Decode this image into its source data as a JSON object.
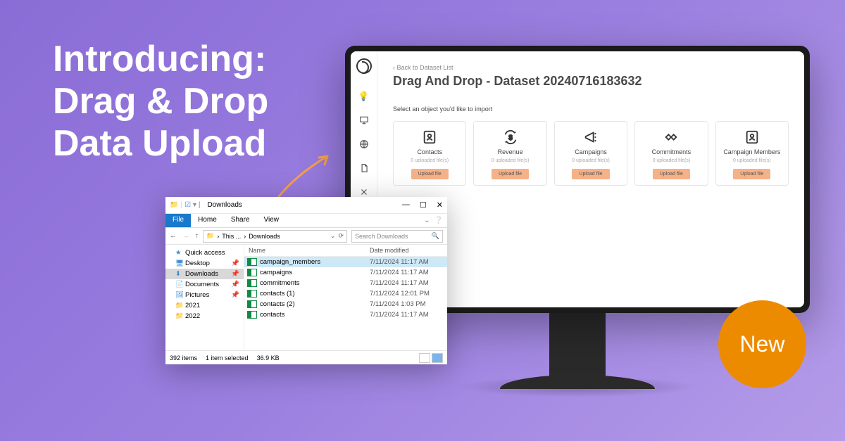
{
  "hero": {
    "line1": "Introducing:",
    "line2": "Drag & Drop",
    "line3": "Data Upload"
  },
  "badge": {
    "label": "New"
  },
  "app": {
    "back_link": "‹ Back to Dataset List",
    "title": "Drag And Drop - Dataset 20240716183632",
    "instruction": "Select an object you'd like to import",
    "upload_label": "Upload file",
    "cards": [
      {
        "name": "Contacts",
        "sub": "0 uploaded file(s)"
      },
      {
        "name": "Revenue",
        "sub": "0 uploaded file(s)"
      },
      {
        "name": "Campaigns",
        "sub": "0 uploaded file(s)"
      },
      {
        "name": "Commitments",
        "sub": "0 uploaded file(s)"
      },
      {
        "name": "Campaign Members",
        "sub": "0 uploaded file(s)"
      }
    ]
  },
  "explorer": {
    "title": "Downloads",
    "tabs": {
      "file": "File",
      "home": "Home",
      "share": "Share",
      "view": "View"
    },
    "breadcrumb": {
      "root": "This ...",
      "current": "Downloads"
    },
    "search_placeholder": "Search Downloads",
    "nav": {
      "quick": "Quick access",
      "desktop": "Desktop",
      "downloads": "Downloads",
      "documents": "Documents",
      "pictures": "Pictures",
      "y2021": "2021",
      "y2022": "2022"
    },
    "columns": {
      "name": "Name",
      "date": "Date modified"
    },
    "files": [
      {
        "name": "campaign_members",
        "date": "7/11/2024 11:17 AM",
        "selected": true
      },
      {
        "name": "campaigns",
        "date": "7/11/2024 11:17 AM"
      },
      {
        "name": "commitments",
        "date": "7/11/2024 11:17 AM"
      },
      {
        "name": "contacts (1)",
        "date": "7/11/2024 12:01 PM"
      },
      {
        "name": "contacts (2)",
        "date": "7/11/2024 1:03 PM"
      },
      {
        "name": "contacts",
        "date": "7/11/2024 11:17 AM"
      }
    ],
    "status": {
      "count": "392 items",
      "selection": "1 item selected",
      "size": "36.9 KB"
    }
  }
}
